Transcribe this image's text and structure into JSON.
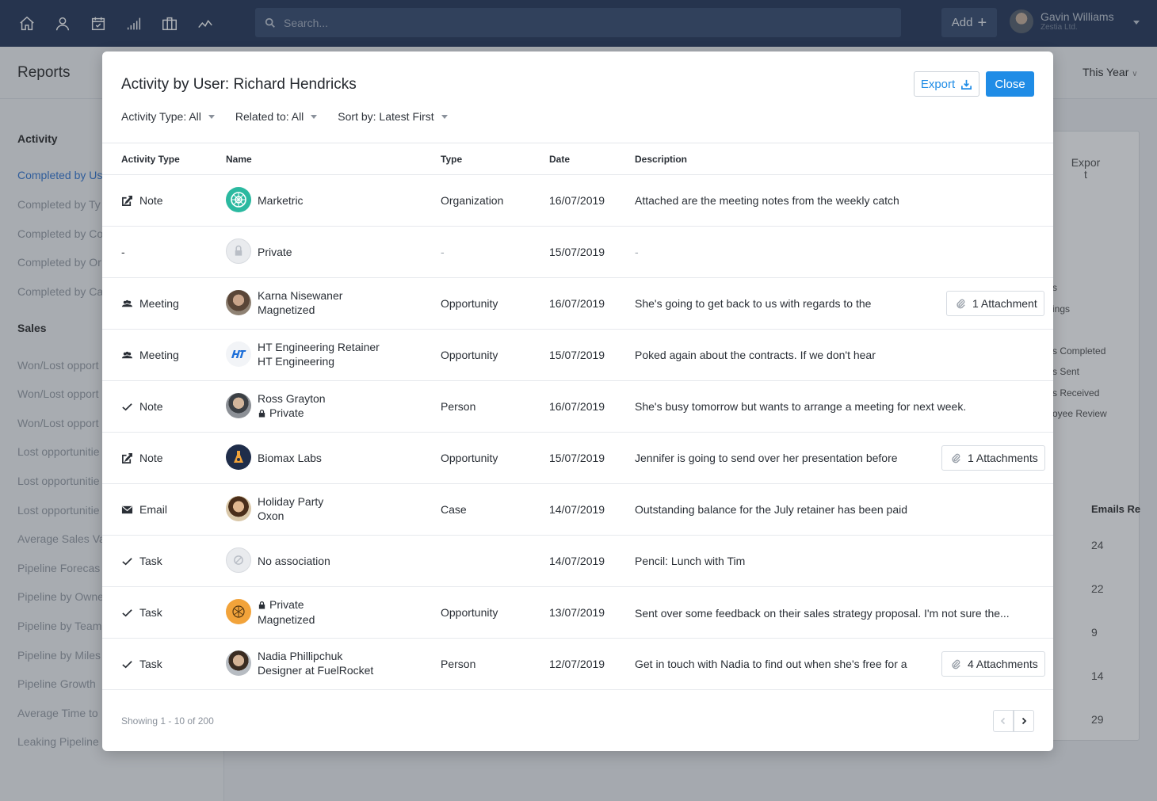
{
  "topbar": {
    "nav_icons": [
      "home-icon",
      "user-icon",
      "calendar-icon",
      "bar-chart-icon",
      "briefcase-icon",
      "trend-icon"
    ],
    "search_placeholder": "Search...",
    "add_label": "Add",
    "user_name": "Gavin Williams",
    "user_org": "Zestia Ltd."
  },
  "page": {
    "title": "Reports",
    "period": "This Year"
  },
  "sidebar": {
    "activity_head": "Activity",
    "activity_items": [
      "Completed by Us",
      "Completed by Ty",
      "Completed by Co",
      "Completed by Or",
      "Completed by Ca"
    ],
    "sales_head": "Sales",
    "sales_items": [
      "Won/Lost opport",
      "Won/Lost opport",
      "Won/Lost opport",
      "Lost opportunitie",
      "Lost opportunitie",
      "Lost opportunitie",
      "Average Sales Va",
      "Pipeline Forecas",
      "Pipeline by Owne",
      "Pipeline by Team",
      "Pipeline by Miles",
      "Pipeline Growth",
      "Average Time to",
      "Leaking Pipeline"
    ]
  },
  "bg_card": {
    "export_label": "Expor t",
    "list": [
      "s",
      "ings",
      "s Completed",
      "s Sent",
      "s Received",
      "oyee Review"
    ],
    "column_head": "Emails Re",
    "values": [
      "24",
      "22",
      "9",
      "14",
      "29"
    ]
  },
  "modal": {
    "title": "Activity by User: Richard Hendricks",
    "export_label": "Export",
    "close_label": "Close",
    "filters": [
      "Activity Type: All",
      "Related to: All",
      "Sort by: Latest First"
    ],
    "columns": [
      "Activity Type",
      "Name",
      "Type",
      "Date",
      "Description"
    ],
    "rows": [
      {
        "activity": "Note",
        "act_icon": "edit-icon",
        "name": "Marketric",
        "sub": "",
        "sub_private": false,
        "type": "Organization",
        "date": "16/07/2019",
        "description": "Attached are the meeting notes from the weekly catch",
        "attachment": ""
      },
      {
        "activity": "-",
        "act_icon": "",
        "name": "Private",
        "sub": "",
        "sub_private": false,
        "type": "-",
        "date": "15/07/2019",
        "description": "-",
        "attachment": ""
      },
      {
        "activity": "Meeting",
        "act_icon": "people-icon",
        "name": "Karna Nisewaner",
        "sub": "Magnetized",
        "sub_private": false,
        "type": "Opportunity",
        "date": "16/07/2019",
        "description": "She's going to get back to us with regards to the",
        "attachment": "1 Attachment"
      },
      {
        "activity": "Meeting",
        "act_icon": "people-icon",
        "name": "HT Engineering Retainer",
        "sub": "HT Engineering",
        "sub_private": false,
        "type": "Opportunity",
        "date": "15/07/2019",
        "description": "Poked again about the contracts. If we don't hear",
        "attachment": ""
      },
      {
        "activity": "Note",
        "act_icon": "check-icon",
        "name": "Ross Grayton",
        "sub": "Private",
        "sub_private": true,
        "type": "Person",
        "date": "16/07/2019",
        "description": "She's busy tomorrow but wants to arrange a meeting for next week.",
        "attachment": ""
      },
      {
        "activity": "Note",
        "act_icon": "edit-icon",
        "name": "Biomax Labs",
        "sub": "",
        "sub_private": false,
        "type": "Opportunity",
        "date": "15/07/2019",
        "description": "Jennifer is going to send over her presentation before",
        "attachment": "1 Attachments"
      },
      {
        "activity": "Email",
        "act_icon": "mail-icon",
        "name": "Holiday Party",
        "sub": "Oxon",
        "sub_private": false,
        "type": "Case",
        "date": "14/07/2019",
        "description": "Outstanding balance for the July retainer has been paid",
        "attachment": ""
      },
      {
        "activity": "Task",
        "act_icon": "check-icon",
        "name": "No association",
        "sub": "",
        "sub_private": false,
        "type": "",
        "date": "14/07/2019",
        "description": "Pencil: Lunch with Tim",
        "attachment": ""
      },
      {
        "activity": "Task",
        "act_icon": "check-icon",
        "name": "Private",
        "sub": "Magnetized",
        "sub_private": false,
        "name_private": true,
        "type": "Opportunity",
        "date": "13/07/2019",
        "description": "Sent over some feedback on their sales strategy proposal. I'm not sure the...",
        "attachment": ""
      },
      {
        "activity": "Task",
        "act_icon": "check-icon",
        "name": "Nadia Phillipchuk",
        "sub": "Designer at FuelRocket",
        "sub_private": false,
        "type": "Person",
        "date": "12/07/2019",
        "description": "Get in touch with Nadia to find out when she's free for a",
        "attachment": "4 Attachments"
      }
    ],
    "showing": "Showing 1 - 10 of 200"
  }
}
